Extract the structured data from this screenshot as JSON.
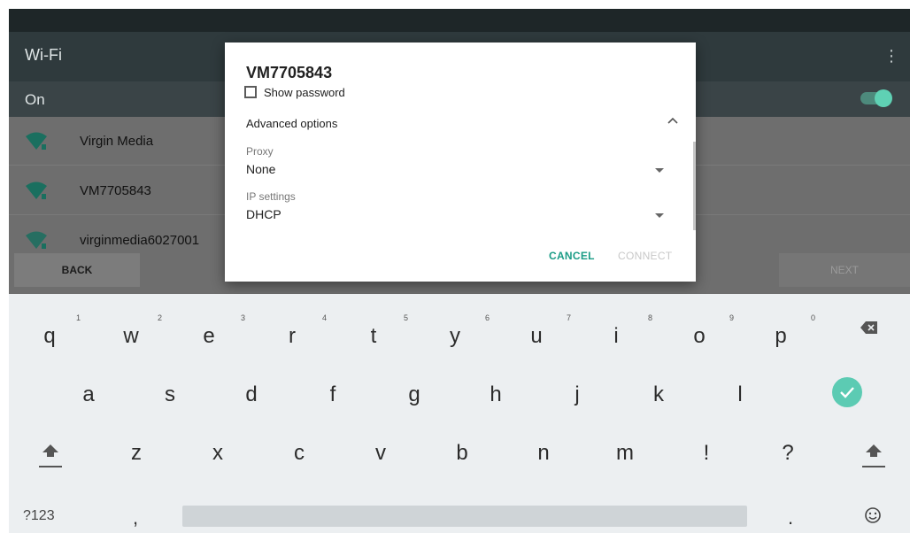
{
  "wifi_screen": {
    "title": "Wi-Fi",
    "menu_icon": "more-vert-icon",
    "state_label": "On",
    "toggle_on": true,
    "networks": [
      {
        "name": "Virgin Media"
      },
      {
        "name": "VM7705843"
      },
      {
        "name": "virginmedia6027001"
      }
    ],
    "back_label": "BACK",
    "next_label": "NEXT"
  },
  "dialog": {
    "title": "VM7705843",
    "show_password_label": "Show password",
    "show_password_checked": false,
    "advanced_label": "Advanced options",
    "proxy_label": "Proxy",
    "proxy_value": "None",
    "ip_label": "IP settings",
    "ip_value": "DHCP",
    "cancel_label": "CANCEL",
    "connect_label": "CONNECT"
  },
  "keyboard": {
    "row1": [
      "q",
      "w",
      "e",
      "r",
      "t",
      "y",
      "u",
      "i",
      "o",
      "p"
    ],
    "row1_hints": [
      "1",
      "2",
      "3",
      "4",
      "5",
      "6",
      "7",
      "8",
      "9",
      "0"
    ],
    "row2": [
      "a",
      "s",
      "d",
      "f",
      "g",
      "h",
      "j",
      "k",
      "l"
    ],
    "row3": [
      "z",
      "x",
      "c",
      "v",
      "b",
      "n",
      "m",
      "!",
      "?"
    ],
    "symbols_label": "?123",
    "comma": ",",
    "period": "."
  },
  "colors": {
    "accent": "#1b9c86",
    "enter_key": "#5ccbb3",
    "toggle_knob": "#5fd1b4"
  }
}
